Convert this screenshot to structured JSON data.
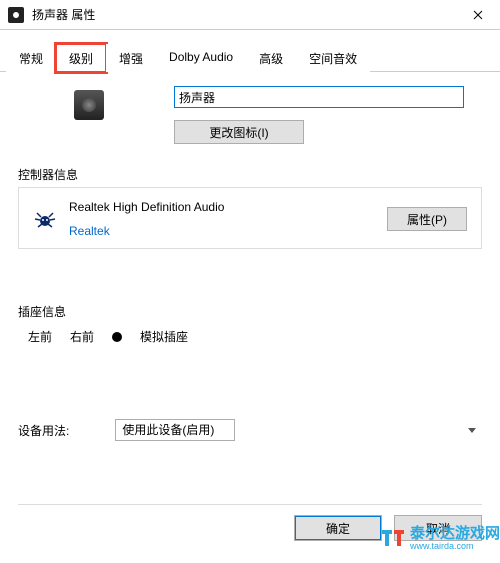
{
  "titlebar": {
    "title": "扬声器 属性",
    "app_icon": "speaker-app-icon",
    "close_icon": "close-icon"
  },
  "tabs": [
    {
      "label": "常规"
    },
    {
      "label": "级别"
    },
    {
      "label": "增强"
    },
    {
      "label": "Dolby Audio"
    },
    {
      "label": "高级"
    },
    {
      "label": "空间音效"
    }
  ],
  "general": {
    "device_input_value": "扬声器",
    "change_icon_label": "更改图标(I)",
    "speaker_icon": "speaker-icon"
  },
  "controller": {
    "group_label": "控制器信息",
    "name": "Realtek High Definition Audio",
    "vendor": "Realtek",
    "prop_button": "属性(P)",
    "icon": "realtek-crab-icon"
  },
  "jack": {
    "group_label": "插座信息",
    "left_front": "左前",
    "right_front": "右前",
    "analog_jack": "模拟插座",
    "dot_icon": "jack-dot-icon"
  },
  "usage": {
    "label": "设备用法:",
    "selected": "使用此设备(启用)"
  },
  "footer": {
    "ok": "确定",
    "cancel": "取消"
  },
  "watermark": {
    "text": "泰尔达游戏网",
    "sub": "www.tairda.com",
    "icon": "tairda-logo"
  },
  "colors": {
    "accent": "#0078d7",
    "link": "#0066cc",
    "highlight": "#e43",
    "brand": "#2aa8e0"
  }
}
